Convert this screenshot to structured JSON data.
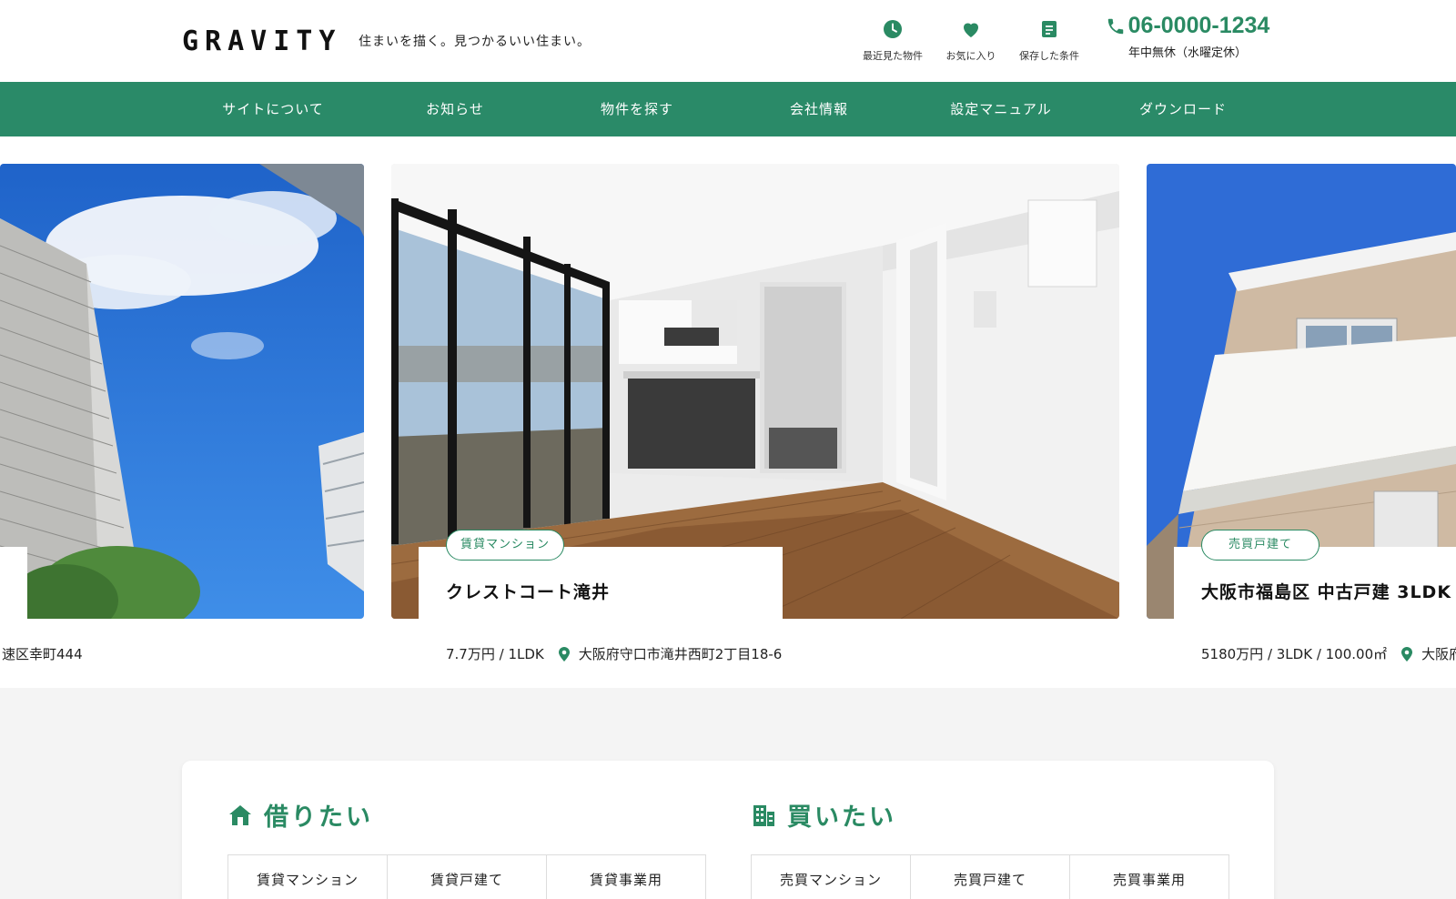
{
  "header": {
    "logo": "GRAVITY",
    "tagline": "住まいを描く。見つかるいい住まい。",
    "utilities": [
      {
        "label": "最近見た物件",
        "icon": "clock-icon"
      },
      {
        "label": "お気に入り",
        "icon": "heart-icon"
      },
      {
        "label": "保存した条件",
        "icon": "document-icon"
      }
    ],
    "phone": {
      "number": "06-0000-1234",
      "hours": "年中無休（水曜定休）",
      "icon": "phone-icon"
    }
  },
  "nav": {
    "items": [
      "サイトについて",
      "お知らせ",
      "物件を探す",
      "会社情報",
      "設定マニュアル",
      "ダウンロード"
    ]
  },
  "carousel": {
    "slides": [
      {
        "meta_address": "速区幸町444"
      },
      {
        "badge": "賃貸マンション",
        "title": "クレストコート滝井",
        "meta": "7.7万円 / 1LDK",
        "address": "大阪府守口市滝井西町2丁目18-6"
      },
      {
        "badge": "売買戸建て",
        "title": "大阪市福島区 中古戸建 3LDK",
        "meta": "5180万円 / 3LDK / 100.00㎡",
        "address": "大阪府"
      }
    ]
  },
  "search": {
    "rent": {
      "title": "借りたい",
      "icon": "house-icon",
      "tabs": [
        "賃貸マンション",
        "賃貸戸建て",
        "賃貸事業用"
      ]
    },
    "buy": {
      "title": "買いたい",
      "icon": "building-icon",
      "tabs": [
        "売買マンション",
        "売買戸建て",
        "売買事業用"
      ]
    }
  },
  "colors": {
    "accent": "#2a8a63",
    "nav_bg": "#2a8a68",
    "section_bg": "#f4f4f4"
  }
}
